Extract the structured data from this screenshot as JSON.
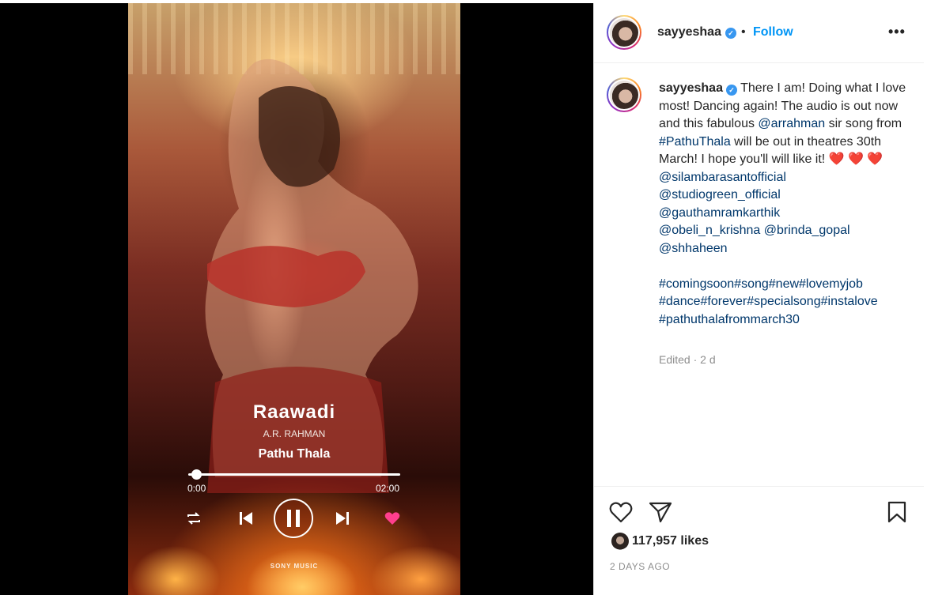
{
  "player": {
    "song_title": "Raawadi",
    "artist": "A.R. RAHMAN",
    "album": "Pathu Thala",
    "time_elapsed": "0:00",
    "time_total": "02:00",
    "progress": 0.04,
    "watermark": "SONY MUSIC",
    "accent_color": "#ff3f8e"
  },
  "post": {
    "username": "sayyeshaa",
    "verified": true,
    "separator": "•",
    "follow_label": "Follow",
    "more_icon": "more-options-icon",
    "caption": {
      "username": "sayyeshaa",
      "text_1": " There I am! Doing what I love most! Dancing again! The audio is out now and this fabulous ",
      "mention_rahman": "@arrahman",
      "text_2": " sir song from ",
      "hashtag_pathuthala": "#PathuThala",
      "text_3": " will be out in theatres 30th March! I hope you'll will like it! ",
      "hearts": "❤️ ❤️ ❤️",
      "mentions": [
        "@silambarasantofficial",
        "@studiogreen_official",
        "@gauthamramkarthik",
        "@obeli_n_krishna",
        "@brinda_gopal",
        "@shhaheen"
      ],
      "hashtags": [
        "#comingsoon",
        "#song",
        "#new",
        "#lovemyjob",
        "#dance",
        "#forever",
        "#specialsong",
        "#instalove",
        "#pathuthalafrommarch30"
      ]
    },
    "edited_label": "Edited · 2 d",
    "likes_count": "117,957 likes",
    "posted_ago": "2 DAYS AGO",
    "colors": {
      "link": "#00376b",
      "follow": "#0095f6",
      "muted": "#8e8e8e"
    }
  }
}
